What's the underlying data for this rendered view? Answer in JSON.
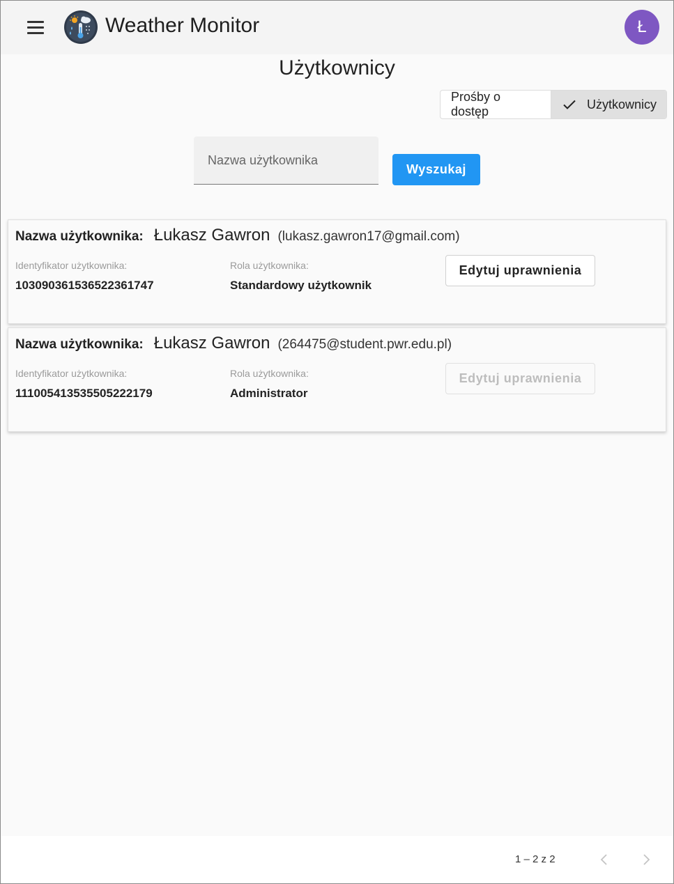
{
  "header": {
    "app_title": "Weather Monitor",
    "avatar_letter": "Ł",
    "menu_icon": "hamburger-menu-icon",
    "logo_icon": "weather-logo-icon"
  },
  "page": {
    "title": "Użytkownicy"
  },
  "toggle": {
    "requests_label": "Prośby o dostęp",
    "users_label": "Użytkownicy",
    "selected": "users"
  },
  "search": {
    "placeholder": "Nazwa użytkownika",
    "value": "",
    "button_label": "Wyszukaj"
  },
  "users": [
    {
      "name_label": "Nazwa użytkownika:",
      "name": "Łukasz Gawron",
      "email": "(lukasz.gawron17@gmail.com)",
      "id_label": "Identyfikator użytkownika:",
      "id": "103090361536522361747",
      "role_label": "Rola użytkownika:",
      "role": "Standardowy użytkownik",
      "edit_label": "Edytuj uprawnienia",
      "edit_enabled": true
    },
    {
      "name_label": "Nazwa użytkownika:",
      "name": "Łukasz Gawron",
      "email": "(264475@student.pwr.edu.pl)",
      "id_label": "Identyfikator użytkownika:",
      "id": "111005413535505222179",
      "role_label": "Rola użytkownika:",
      "role": "Administrator",
      "edit_label": "Edytuj uprawnienia",
      "edit_enabled": false
    }
  ],
  "paginator": {
    "range_label": "1 – 2 z 2",
    "prev_icon": "chevron-left-icon",
    "next_icon": "chevron-right-icon"
  },
  "colors": {
    "accent": "#2196f3",
    "avatar": "#7e57c2",
    "toolbar": "#f4f4f4"
  }
}
